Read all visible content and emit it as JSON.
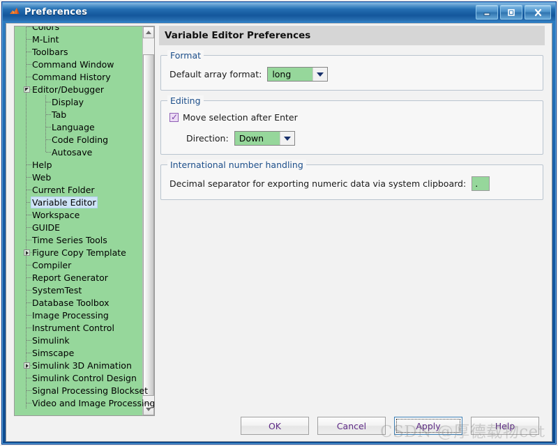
{
  "window": {
    "title": "Preferences",
    "icon": "matlab-membrane-icon",
    "controls": {
      "minimize": "minimize-button",
      "maximize": "maximize-button",
      "close": "close-button"
    }
  },
  "sidebar": {
    "scrollbar": {
      "up_arrow": "scroll-up-arrow",
      "down_arrow": "scroll-down-arrow"
    },
    "items": [
      {
        "label": "Colors",
        "depth": 0,
        "expander": "none",
        "selected": false,
        "clipped_top": true
      },
      {
        "label": "M-Lint",
        "depth": 0,
        "expander": "none",
        "selected": false
      },
      {
        "label": "Toolbars",
        "depth": 0,
        "expander": "none",
        "selected": false
      },
      {
        "label": "Command Window",
        "depth": 0,
        "expander": "none",
        "selected": false
      },
      {
        "label": "Command History",
        "depth": 0,
        "expander": "none",
        "selected": false
      },
      {
        "label": "Editor/Debugger",
        "depth": 0,
        "expander": "expanded",
        "selected": false
      },
      {
        "label": "Display",
        "depth": 1,
        "expander": "none",
        "selected": false
      },
      {
        "label": "Tab",
        "depth": 1,
        "expander": "none",
        "selected": false
      },
      {
        "label": "Language",
        "depth": 1,
        "expander": "none",
        "selected": false
      },
      {
        "label": "Code Folding",
        "depth": 1,
        "expander": "none",
        "selected": false
      },
      {
        "label": "Autosave",
        "depth": 1,
        "expander": "none",
        "selected": false
      },
      {
        "label": "Help",
        "depth": 0,
        "expander": "none",
        "selected": false
      },
      {
        "label": "Web",
        "depth": 0,
        "expander": "none",
        "selected": false
      },
      {
        "label": "Current Folder",
        "depth": 0,
        "expander": "none",
        "selected": false
      },
      {
        "label": "Variable Editor",
        "depth": 0,
        "expander": "none",
        "selected": true
      },
      {
        "label": "Workspace",
        "depth": 0,
        "expander": "none",
        "selected": false
      },
      {
        "label": "GUIDE",
        "depth": 0,
        "expander": "none",
        "selected": false
      },
      {
        "label": "Time Series Tools",
        "depth": 0,
        "expander": "none",
        "selected": false
      },
      {
        "label": "Figure Copy Template",
        "depth": 0,
        "expander": "collapsed",
        "selected": false
      },
      {
        "label": "Compiler",
        "depth": 0,
        "expander": "none",
        "selected": false
      },
      {
        "label": "Report Generator",
        "depth": 0,
        "expander": "none",
        "selected": false
      },
      {
        "label": "SystemTest",
        "depth": 0,
        "expander": "none",
        "selected": false
      },
      {
        "label": "Database Toolbox",
        "depth": 0,
        "expander": "none",
        "selected": false
      },
      {
        "label": "Image Processing",
        "depth": 0,
        "expander": "none",
        "selected": false
      },
      {
        "label": "Instrument Control",
        "depth": 0,
        "expander": "none",
        "selected": false
      },
      {
        "label": "Simulink",
        "depth": 0,
        "expander": "none",
        "selected": false
      },
      {
        "label": "Simscape",
        "depth": 0,
        "expander": "none",
        "selected": false
      },
      {
        "label": "Simulink 3D Animation",
        "depth": 0,
        "expander": "collapsed",
        "selected": false
      },
      {
        "label": "Simulink Control Design",
        "depth": 0,
        "expander": "none",
        "selected": false
      },
      {
        "label": "Signal Processing Blockset",
        "depth": 0,
        "expander": "none",
        "selected": false
      },
      {
        "label": "Video and Image Processing",
        "depth": 0,
        "expander": "none",
        "selected": false
      }
    ]
  },
  "main": {
    "header_title": "Variable Editor Preferences",
    "groups": {
      "format": {
        "title": "Format",
        "array_format_label": "Default array format:",
        "array_format_value": "long"
      },
      "editing": {
        "title": "Editing",
        "move_selection_label": "Move selection after Enter",
        "move_selection_checked": true,
        "direction_label": "Direction:",
        "direction_value": "Down"
      },
      "international": {
        "title": "International number handling",
        "decimal_separator_label": "Decimal separator for exporting numeric data via system clipboard:",
        "decimal_separator_value": "."
      }
    }
  },
  "buttons": {
    "ok": "OK",
    "cancel": "Cancel",
    "apply": "Apply",
    "help": "Help"
  },
  "watermark": {
    "text": "CSDN @厚德载物cet"
  },
  "colors": {
    "tree_background": "#96d79b",
    "selection": "#cfe4f7",
    "group_title": "#1c4e8a",
    "button_text": "#5e2a86",
    "titlebar": "#1c62a6"
  }
}
